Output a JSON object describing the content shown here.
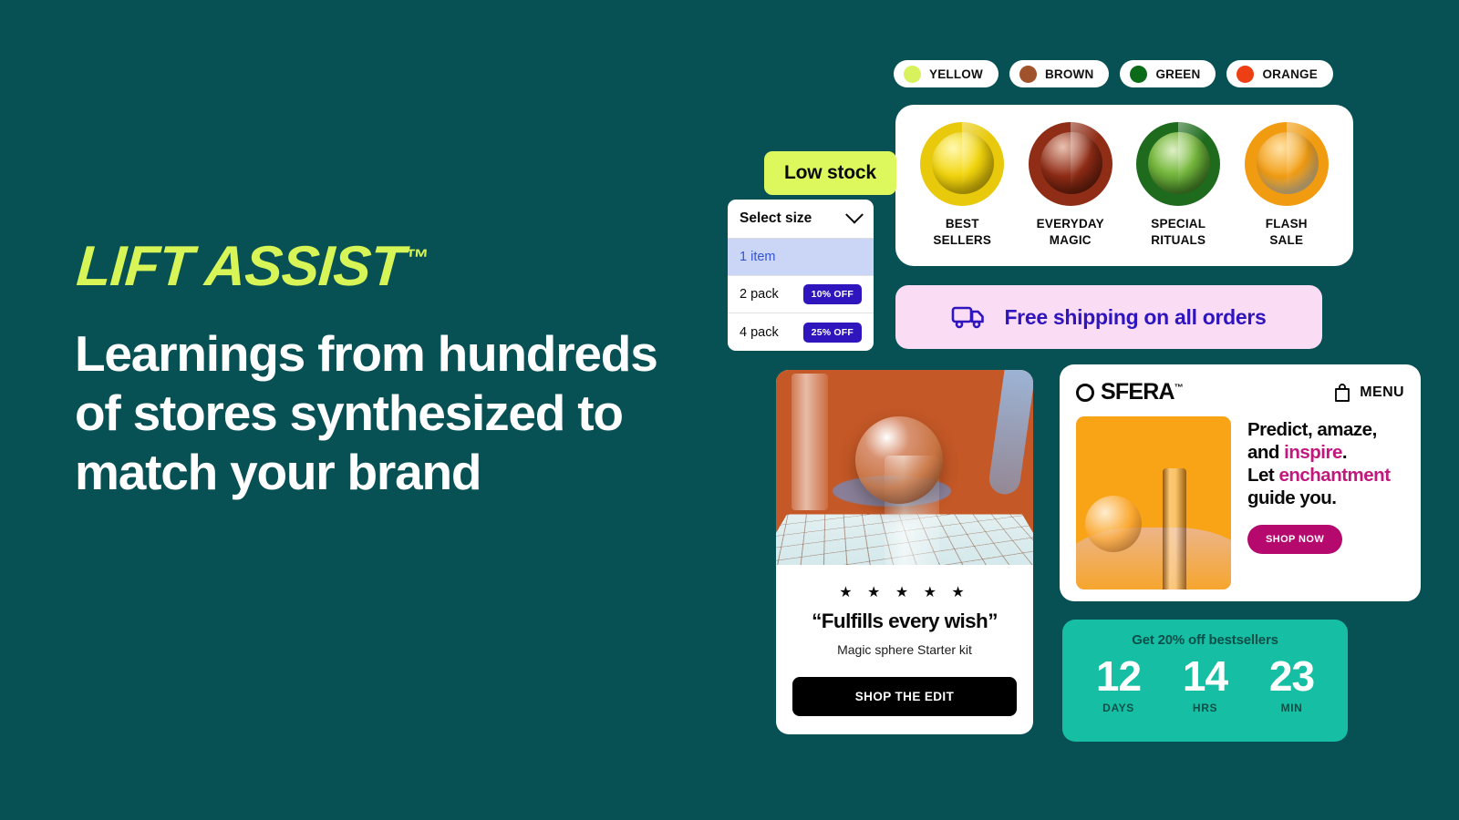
{
  "theme": {
    "background": "#075054",
    "lime": "#DCF85C",
    "indigo": "#2F15BE",
    "pink_bg": "#FADCF5",
    "magenta": "#B5096E",
    "teal": "#16BFA4"
  },
  "hero": {
    "logo": "LIFT ASSIST",
    "logo_tm": "™",
    "headline": "Learnings from hundreds of stores synthesized to match your brand"
  },
  "color_pills": [
    {
      "label": "YELLOW",
      "swatch": "#D8F25E"
    },
    {
      "label": "BROWN",
      "swatch": "#A0522A"
    },
    {
      "label": "GREEN",
      "swatch": "#0B6B18"
    },
    {
      "label": "ORANGE",
      "swatch": "#EE3E14"
    }
  ],
  "categories": [
    {
      "label": "BEST\nSELLERS",
      "line1": "BEST",
      "line2": "SELLERS",
      "color": "#E8C90B"
    },
    {
      "label": "EVERYDAY MAGIC",
      "line1": "EVERYDAY",
      "line2": "MAGIC",
      "color": "#8F2D16"
    },
    {
      "label": "SPECIAL RITUALS",
      "line1": "SPECIAL",
      "line2": "RITUALS",
      "color": "#1E6B1E"
    },
    {
      "label": "FLASH SALE",
      "line1": "FLASH",
      "line2": "SALE",
      "color": "#F09B10"
    }
  ],
  "low_stock": {
    "label": "Low stock"
  },
  "size_select": {
    "placeholder": "Select size",
    "chevron_icon": "chevron-down-icon",
    "options": [
      {
        "name": "1 item",
        "badge": "",
        "selected": true
      },
      {
        "name": "2 pack",
        "badge": "10% OFF",
        "selected": false
      },
      {
        "name": "4 pack",
        "badge": "25% OFF",
        "selected": false
      }
    ]
  },
  "shipping": {
    "icon": "truck-icon",
    "text": "Free shipping on all orders"
  },
  "review_card": {
    "stars": "★ ★ ★ ★ ★",
    "rating": 5,
    "quote": "“Fulfills every wish”",
    "subtitle": "Magic sphere Starter kit",
    "cta": "SHOP THE EDIT"
  },
  "sfera_card": {
    "brand": "SFERA",
    "brand_tm": "™",
    "logo_icon": "circle-outline-icon",
    "menu_label": "MENU",
    "menu_icon": "shopping-bag-icon",
    "headline_parts": [
      {
        "text": "Predict, amaze,",
        "pink": false
      },
      {
        "text": "and ",
        "pink": false
      },
      {
        "text": "inspire",
        "pink": true
      },
      {
        "text": ".",
        "pink": false
      },
      {
        "text": "Let ",
        "pink": false
      },
      {
        "text": "enchantment",
        "pink": true
      },
      {
        "text": "guide you.",
        "pink": false
      }
    ],
    "line1": "Predict, amaze,",
    "line2_pre": "and ",
    "line2_hl": "inspire",
    "line2_post": ".",
    "line3_pre": "Let ",
    "line3_hl": "enchantment",
    "line4": "guide you.",
    "cta": "SHOP NOW"
  },
  "countdown": {
    "title": "Get 20% off bestsellers",
    "units": [
      {
        "value": "12",
        "label": "DAYS"
      },
      {
        "value": "14",
        "label": "HRS"
      },
      {
        "value": "23",
        "label": "MIN"
      }
    ]
  }
}
